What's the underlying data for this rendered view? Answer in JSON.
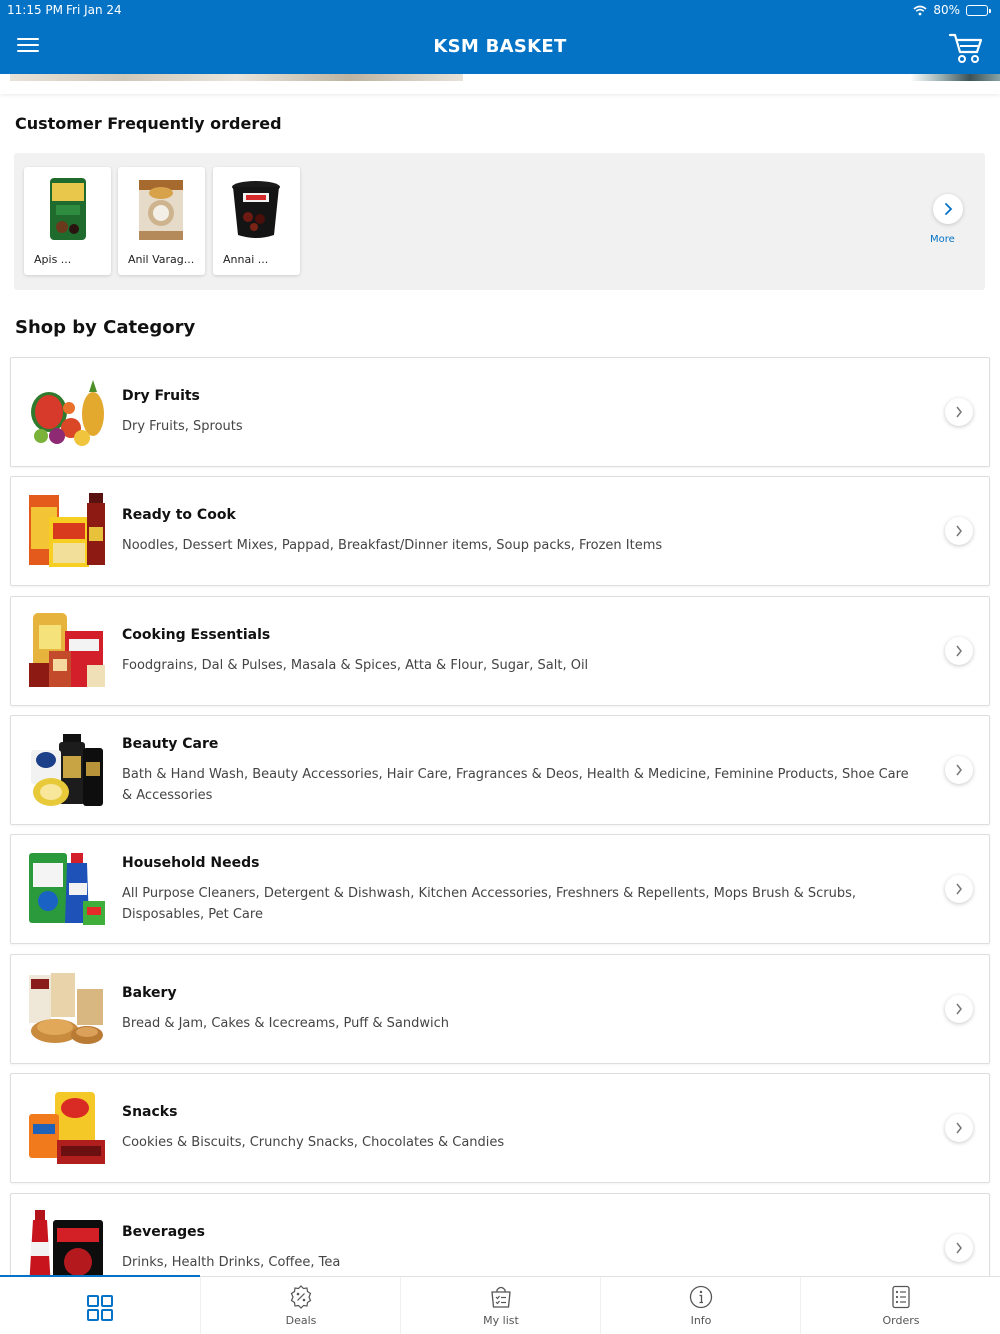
{
  "status_bar": {
    "time": "11:15 PM",
    "date": "Fri Jan 24",
    "battery": "80%"
  },
  "header": {
    "title": "KSM BASKET",
    "menu_icon": "hamburger-icon",
    "cart_icon": "cart-icon"
  },
  "colors": {
    "brand": "#0473c6",
    "background": "#ffffff",
    "panel": "#f1f1f1"
  },
  "frequently_ordered": {
    "title": "Customer Frequently ordered",
    "items": [
      {
        "label": "Apis ..."
      },
      {
        "label": "Anil Varag..."
      },
      {
        "label": "Annai ..."
      }
    ],
    "more_label": "More"
  },
  "shop_by_category": {
    "title": "Shop by Category",
    "categories": [
      {
        "name": "Dry Fruits",
        "description": "Dry Fruits, Sprouts"
      },
      {
        "name": "Ready to Cook",
        "description": "Noodles, Dessert Mixes, Pappad, Breakfast/Dinner items, Soup packs, Frozen Items"
      },
      {
        "name": "Cooking Essentials",
        "description": "Foodgrains, Dal & Pulses, Masala & Spices, Atta & Flour, Sugar, Salt, Oil"
      },
      {
        "name": "Beauty Care",
        "description": "Bath & Hand Wash, Beauty Accessories, Hair Care, Fragrances & Deos, Health & Medicine, Feminine Products, Shoe Care & Accessories"
      },
      {
        "name": "Household Needs",
        "description": "All Purpose Cleaners, Detergent & Dishwash, Kitchen Accessories, Freshners & Repellents, Mops Brush & Scrubs, Disposables, Pet Care"
      },
      {
        "name": "Bakery",
        "description": "Bread & Jam, Cakes & Icecreams, Puff & Sandwich"
      },
      {
        "name": "Snacks",
        "description": "Cookies & Biscuits, Crunchy Snacks, Chocolates & Candies"
      },
      {
        "name": "Beverages",
        "description": "Drinks, Health Drinks, Coffee, Tea"
      }
    ]
  },
  "tabbar": {
    "tabs": [
      {
        "label": "",
        "icon": "grid-icon",
        "active": true
      },
      {
        "label": "Deals",
        "icon": "discount-icon"
      },
      {
        "label": "My list",
        "icon": "shopping-list-icon"
      },
      {
        "label": "Info",
        "icon": "info-icon"
      },
      {
        "label": "Orders",
        "icon": "orders-icon"
      }
    ]
  }
}
